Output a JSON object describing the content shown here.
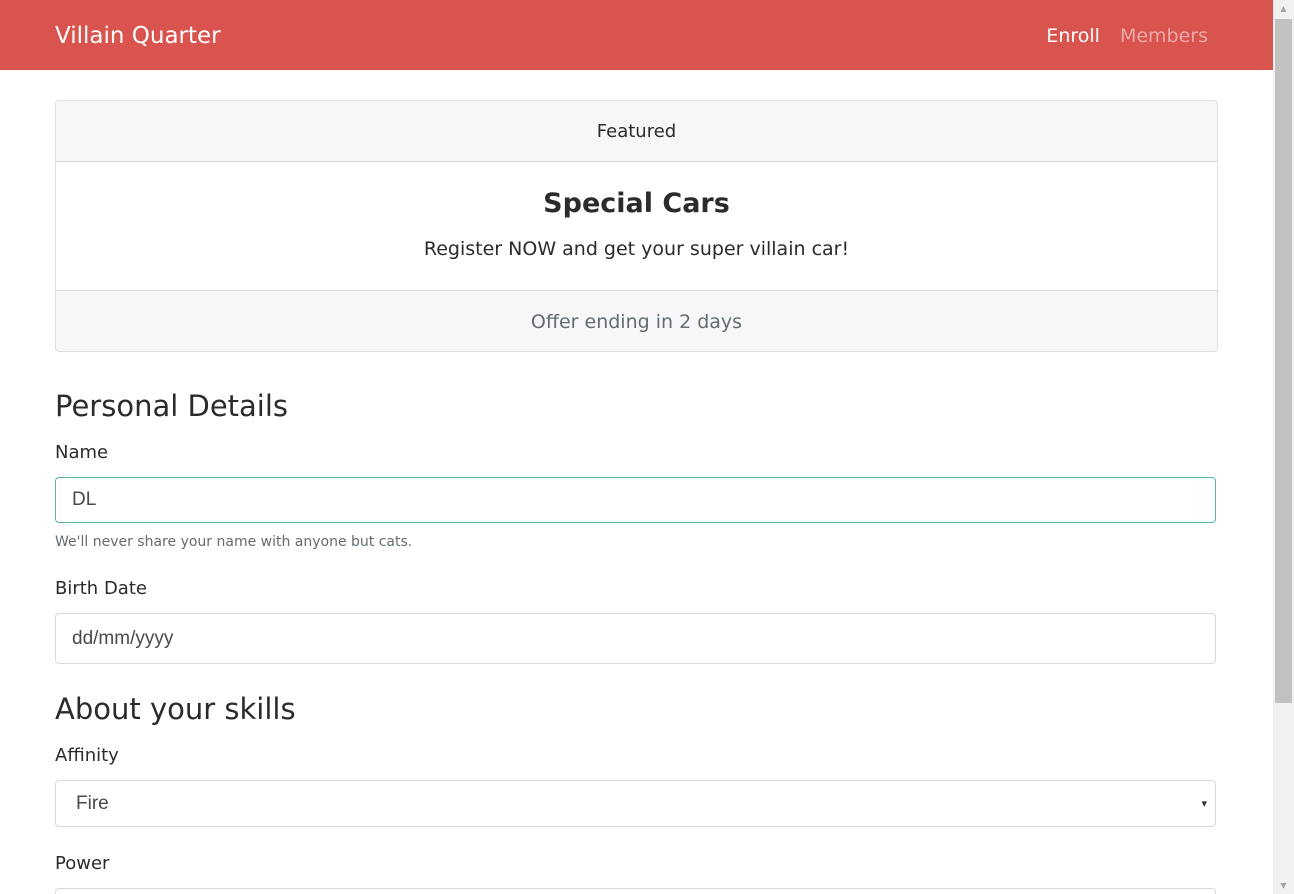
{
  "navbar": {
    "brand": "Villain Quarter",
    "links": [
      {
        "label": "Enroll"
      },
      {
        "label": "Members"
      }
    ]
  },
  "card": {
    "header": "Featured",
    "title": "Special Cars",
    "text": "Register NOW and get your super villain car!",
    "footer": "Offer ending in 2 days"
  },
  "form": {
    "personal_title": "Personal Details",
    "name": {
      "label": "Name",
      "value": "DL",
      "help": "We'll never share your name with anyone but cats."
    },
    "birth_date": {
      "label": "Birth Date",
      "placeholder": "dd/mm/yyyy"
    },
    "skills_title": "About your skills",
    "affinity": {
      "label": "Affinity",
      "selected": "Fire"
    },
    "power": {
      "label": "Power"
    }
  },
  "icons": {
    "select_caret": "▾",
    "scroll_up": "▲",
    "scroll_down": "▼"
  },
  "colors": {
    "navbar_bg": "#d9534f",
    "card_header_bg": "#f7f7f9",
    "focus_border": "#5cb3a6"
  }
}
